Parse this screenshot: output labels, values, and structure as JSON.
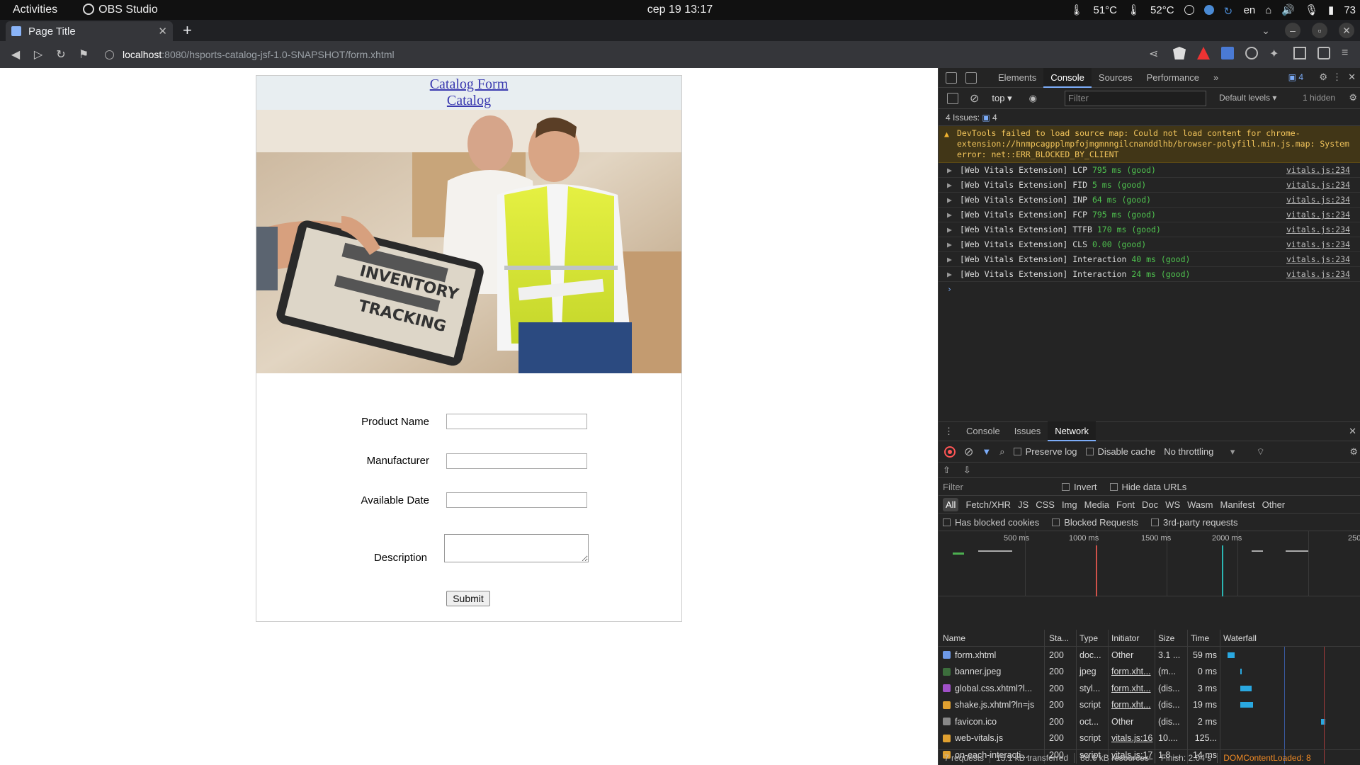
{
  "system_bar": {
    "activities": "Activities",
    "app_name": "OBS Studio",
    "clock": "сер 19  13:17",
    "temp1": "51°C",
    "temp2": "52°C",
    "lang": "en",
    "battery": "73"
  },
  "browser": {
    "tab_title": "Page Title",
    "url_host": "localhost",
    "url_path": ":8080/hsports-catalog-jsf-1.0-SNAPSHOT/form.xhtml"
  },
  "page": {
    "header_link1": "Catalog Form",
    "header_link2": "Catalog",
    "banner_words": [
      "INVENTORY",
      "TRACKING"
    ],
    "fields": {
      "product_name": "Product Name",
      "manufacturer": "Manufacturer",
      "available_date": "Available Date",
      "description": "Description"
    },
    "submit": "Submit"
  },
  "devtools": {
    "tabs": [
      "Elements",
      "Console",
      "Sources",
      "Performance"
    ],
    "active_tab": "Console",
    "issues_badge": "4",
    "context": "top",
    "filter_placeholder": "Filter",
    "levels": "Default levels",
    "hidden": "1 hidden",
    "issues_bar": "4 Issues:",
    "issues_count": "4",
    "warning": {
      "prefix": "DevTools failed to load source map: Could not load content for ",
      "link": "chrome-extension://hnmpcagpplmpfojmgmnngilcnanddlhb/browser-polyfill.min.js.map",
      "suffix": ": System error: net::ERR_BLOCKED_BY_CLIENT"
    },
    "logs": [
      {
        "text": "[Web Vitals Extension] LCP",
        "val": "795 ms (good)",
        "src": "vitals.js:234"
      },
      {
        "text": "[Web Vitals Extension] FID",
        "val": "5 ms (good)",
        "src": "vitals.js:234"
      },
      {
        "text": "[Web Vitals Extension] INP",
        "val": "64 ms (good)",
        "src": "vitals.js:234"
      },
      {
        "text": "[Web Vitals Extension] FCP",
        "val": "795 ms (good)",
        "src": "vitals.js:234"
      },
      {
        "text": "[Web Vitals Extension] TTFB",
        "val": "170 ms (good)",
        "src": "vitals.js:234"
      },
      {
        "text": "[Web Vitals Extension] CLS",
        "val": "0.00 (good)",
        "src": "vitals.js:234"
      },
      {
        "text": "[Web Vitals Extension] Interaction",
        "val": "40 ms (good)",
        "src": "vitals.js:234"
      },
      {
        "text": "[Web Vitals Extension] Interaction",
        "val": "24 ms (good)",
        "src": "vitals.js:234"
      }
    ],
    "drawer_tabs": [
      "Console",
      "Issues",
      "Network"
    ],
    "drawer_active": "Network",
    "network": {
      "preserve_log": "Preserve log",
      "disable_cache": "Disable cache",
      "throttling": "No throttling",
      "filter": "Filter",
      "invert": "Invert",
      "hide_data_urls": "Hide data URLs",
      "types": [
        "All",
        "Fetch/XHR",
        "JS",
        "CSS",
        "Img",
        "Media",
        "Font",
        "Doc",
        "WS",
        "Wasm",
        "Manifest",
        "Other"
      ],
      "blocked_cookies": "Has blocked cookies",
      "blocked_requests": "Blocked Requests",
      "third_party": "3rd-party requests",
      "ticks": [
        "500 ms",
        "1000 ms",
        "1500 ms",
        "2000 ms",
        "250"
      ],
      "columns": [
        "Name",
        "Sta...",
        "Type",
        "Initiator",
        "Size",
        "Time",
        "Waterfall"
      ],
      "rows": [
        {
          "name": "form.xhtml",
          "status": "200",
          "type": "doc...",
          "initiator": "Other",
          "size": "3.1 ...",
          "time": "59 ms",
          "icon_color": "#6e9ae8"
        },
        {
          "name": "banner.jpeg",
          "status": "200",
          "type": "jpeg",
          "initiator": "form.xht...",
          "size": "(m...",
          "time": "0 ms",
          "icon_color": "#3c6e3c"
        },
        {
          "name": "global.css.xhtml?l...",
          "status": "200",
          "type": "styl...",
          "initiator": "form.xht...",
          "size": "(dis...",
          "time": "3 ms",
          "icon_color": "#a050c8"
        },
        {
          "name": "shake.js.xhtml?ln=js",
          "status": "200",
          "type": "script",
          "initiator": "form.xht...",
          "size": "(dis...",
          "time": "19 ms",
          "icon_color": "#e0a030"
        },
        {
          "name": "favicon.ico",
          "status": "200",
          "type": "oct...",
          "initiator": "Other",
          "size": "(dis...",
          "time": "2 ms",
          "icon_color": "#888888"
        },
        {
          "name": "web-vitals.js",
          "status": "200",
          "type": "script",
          "initiator": "vitals.js:16",
          "size": "10....",
          "time": "125...",
          "icon_color": "#e0a030"
        },
        {
          "name": "on-each-interacti...",
          "status": "200",
          "type": "script",
          "initiator": "vitals.js:17",
          "size": "1.8 ...",
          "time": "14 ms",
          "icon_color": "#e0a030"
        }
      ],
      "status": {
        "requests": "7 requests",
        "transferred": "15.1 kB transferred",
        "resources": "88.6 kB resources",
        "finish": "Finish: 2.04 s",
        "dcl": "DOMContentLoaded: 8"
      }
    }
  }
}
